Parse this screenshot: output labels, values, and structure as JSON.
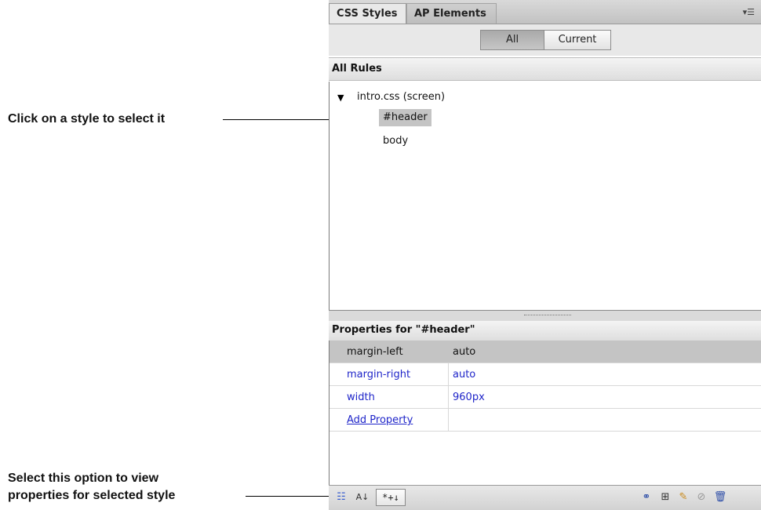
{
  "callouts": {
    "select_style": "Click on a style to select it",
    "view_properties_line1": "Select this option to view",
    "view_properties_line2": "properties for selected style"
  },
  "panel": {
    "tabs": [
      {
        "label": "CSS Styles",
        "active": true
      },
      {
        "label": "AP Elements",
        "active": false
      }
    ],
    "menu_icon": "panel-menu-icon",
    "mode_toggle": [
      {
        "label": "All",
        "selected": true
      },
      {
        "label": "Current",
        "selected": false
      }
    ],
    "all_rules": {
      "heading": "All Rules",
      "stylesheet": "intro.css (screen)",
      "rules": [
        {
          "label": "#header",
          "selected": true
        },
        {
          "label": "body",
          "selected": false
        }
      ]
    },
    "properties": {
      "heading": "Properties for \"#header\"",
      "rows": [
        {
          "name": "margin-left",
          "value": "auto"
        },
        {
          "name": "margin-right",
          "value": "auto"
        },
        {
          "name": "width",
          "value": "960px"
        }
      ],
      "add_property": "Add Property"
    },
    "bottom_toolbar": {
      "show_set_label": "*+↓",
      "left_icons": [
        "category-view-icon",
        "alpha-sort-icon"
      ],
      "right_icons": [
        "attach-stylesheet-icon",
        "new-rule-icon",
        "edit-rule-icon",
        "disable-property-icon",
        "trash-icon"
      ]
    }
  },
  "colors": {
    "property_blue": "#1f25c9",
    "selection_gray": "#c4c4c4"
  }
}
